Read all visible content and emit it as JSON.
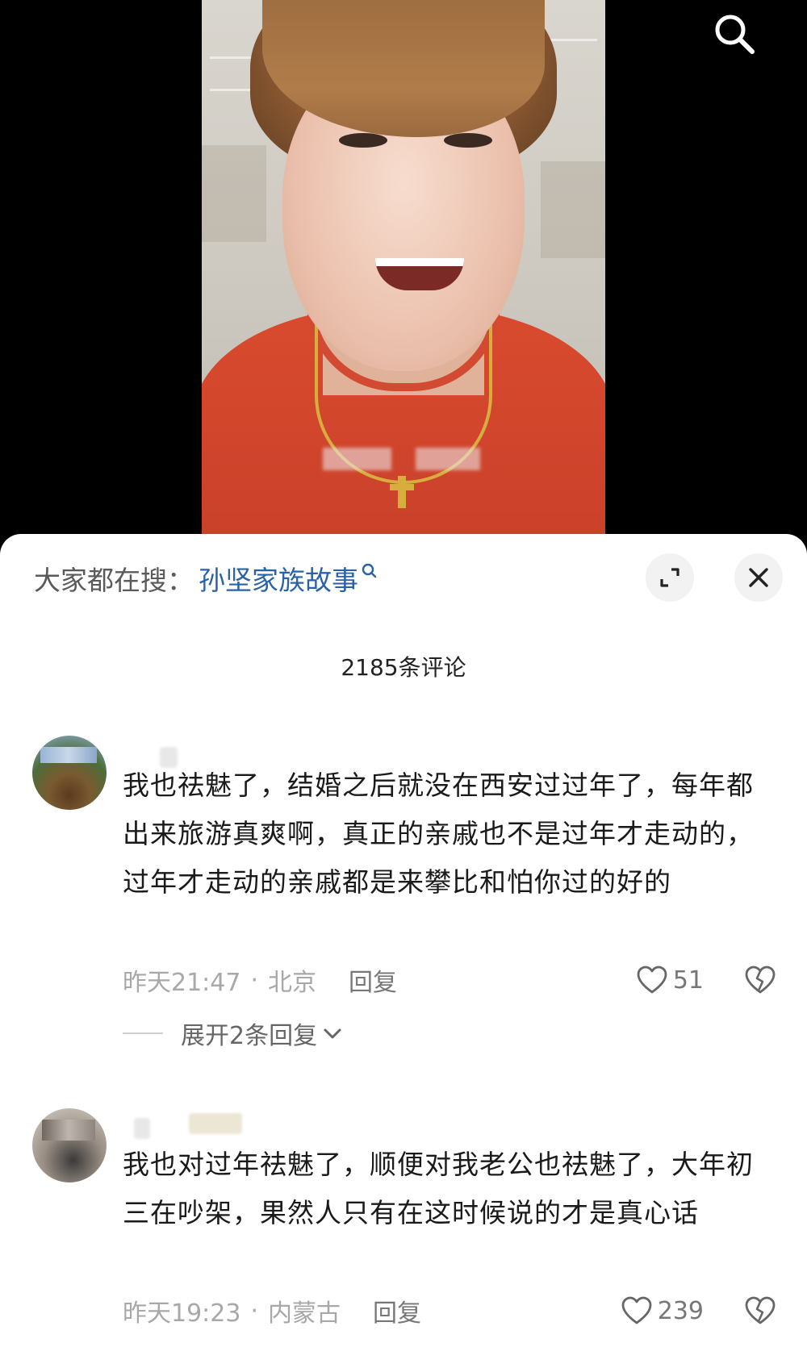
{
  "video": {
    "icons": {
      "search": "search-icon"
    }
  },
  "sheet": {
    "trending": {
      "prefix": "大家都在搜：",
      "term": "孙坚家族故事"
    },
    "comment_count_label": "2185条评论",
    "icons": {
      "expand": "expand-icon",
      "close": "close-icon"
    }
  },
  "comments": [
    {
      "text": "我也祛魅了，结婚之后就没在西安过过年了，每年都出来旅游真爽啊，真正的亲戚也不是过年才走动的，过年才走动的亲戚都是来攀比和怕你过的好的",
      "time": "昨天21:47",
      "separator": "·",
      "location": "北京",
      "reply_label": "回复",
      "likes": "51",
      "expand_replies_label": "展开2条回复"
    },
    {
      "text": "我也对过年祛魅了，顺便对我老公也祛魅了，大年初三在吵架，果然人只有在这时候说的才是真心话",
      "time": "昨天19:23",
      "separator": "·",
      "location": "内蒙古",
      "reply_label": "回复",
      "likes": "239"
    }
  ]
}
